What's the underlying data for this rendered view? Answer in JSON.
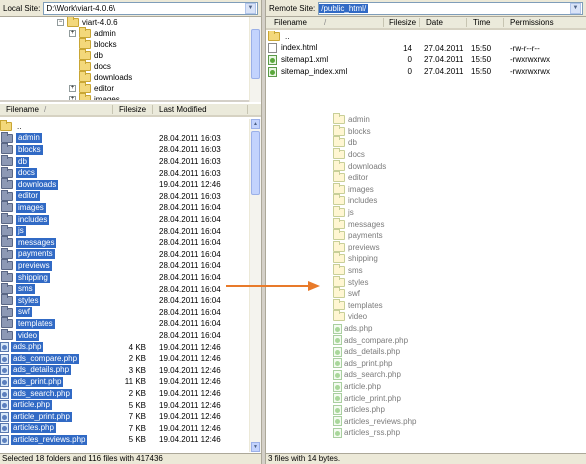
{
  "local": {
    "label": "Local Site:",
    "path": "D:\\Work\\viart-4.0.6\\",
    "tree": [
      {
        "name": "viart-4.0.6",
        "sign": "−",
        "indent": 0
      },
      {
        "name": "admin",
        "sign": "+",
        "indent": 1
      },
      {
        "name": "blocks",
        "sign": "",
        "indent": 1
      },
      {
        "name": "db",
        "sign": "",
        "indent": 1
      },
      {
        "name": "docs",
        "sign": "",
        "indent": 1
      },
      {
        "name": "downloads",
        "sign": "",
        "indent": 1
      },
      {
        "name": "editor",
        "sign": "+",
        "indent": 1
      },
      {
        "name": "images",
        "sign": "+",
        "indent": 1
      }
    ],
    "columns": {
      "name": "Filename",
      "size": "Filesize",
      "modified": "Last Modified",
      "sort": "/"
    },
    "up": "..",
    "rows": [
      {
        "n": "admin",
        "s": "",
        "m": "28.04.2011 16:03",
        "t": "d"
      },
      {
        "n": "blocks",
        "s": "",
        "m": "28.04.2011 16:03",
        "t": "d"
      },
      {
        "n": "db",
        "s": "",
        "m": "28.04.2011 16:03",
        "t": "d"
      },
      {
        "n": "docs",
        "s": "",
        "m": "28.04.2011 16:03",
        "t": "d"
      },
      {
        "n": "downloads",
        "s": "",
        "m": "19.04.2011 12:46",
        "t": "d"
      },
      {
        "n": "editor",
        "s": "",
        "m": "28.04.2011 16:03",
        "t": "d"
      },
      {
        "n": "images",
        "s": "",
        "m": "28.04.2011 16:04",
        "t": "d"
      },
      {
        "n": "includes",
        "s": "",
        "m": "28.04.2011 16:04",
        "t": "d"
      },
      {
        "n": "js",
        "s": "",
        "m": "28.04.2011 16:04",
        "t": "d"
      },
      {
        "n": "messages",
        "s": "",
        "m": "28.04.2011 16:04",
        "t": "d"
      },
      {
        "n": "payments",
        "s": "",
        "m": "28.04.2011 16:04",
        "t": "d"
      },
      {
        "n": "previews",
        "s": "",
        "m": "28.04.2011 16:04",
        "t": "d"
      },
      {
        "n": "shipping",
        "s": "",
        "m": "28.04.2011 16:04",
        "t": "d"
      },
      {
        "n": "sms",
        "s": "",
        "m": "28.04.2011 16:04",
        "t": "d"
      },
      {
        "n": "styles",
        "s": "",
        "m": "28.04.2011 16:04",
        "t": "d"
      },
      {
        "n": "swf",
        "s": "",
        "m": "28.04.2011 16:04",
        "t": "d"
      },
      {
        "n": "templates",
        "s": "",
        "m": "28.04.2011 16:04",
        "t": "d"
      },
      {
        "n": "video",
        "s": "",
        "m": "28.04.2011 16:04",
        "t": "d"
      },
      {
        "n": "ads.php",
        "s": "4 KB",
        "m": "19.04.2011 12:46",
        "t": "f"
      },
      {
        "n": "ads_compare.php",
        "s": "2 KB",
        "m": "19.04.2011 12:46",
        "t": "f"
      },
      {
        "n": "ads_details.php",
        "s": "3 KB",
        "m": "19.04.2011 12:46",
        "t": "f"
      },
      {
        "n": "ads_print.php",
        "s": "11 KB",
        "m": "19.04.2011 12:46",
        "t": "f"
      },
      {
        "n": "ads_search.php",
        "s": "2 KB",
        "m": "19.04.2011 12:46",
        "t": "f"
      },
      {
        "n": "article.php",
        "s": "5 KB",
        "m": "19.04.2011 12:46",
        "t": "f"
      },
      {
        "n": "article_print.php",
        "s": "7 KB",
        "m": "19.04.2011 12:46",
        "t": "f"
      },
      {
        "n": "articles.php",
        "s": "7 KB",
        "m": "19.04.2011 12:46",
        "t": "f"
      },
      {
        "n": "articles_reviews.php",
        "s": "5 KB",
        "m": "19.04.2011 12:46",
        "t": "f"
      }
    ],
    "status": "Selected 18 folders and 116 files with 417436"
  },
  "remote": {
    "label": "Remote Site:",
    "path": "/public_html/",
    "columns": {
      "name": "Filename",
      "sort": "/",
      "size": "Filesize",
      "date": "Date",
      "time": "Time",
      "perm": "Permissions"
    },
    "up": "..",
    "rows": [
      {
        "n": "index.html",
        "s": "14",
        "d": "27.04.2011",
        "t": "15:50",
        "p": "-rw-r--r--",
        "k": "html"
      },
      {
        "n": "sitemap1.xml",
        "s": "0",
        "d": "27.04.2011",
        "t": "15:50",
        "p": "-rwxrwxrwx",
        "k": "xml"
      },
      {
        "n": "sitemap_index.xml",
        "s": "0",
        "d": "27.04.2011",
        "t": "15:50",
        "p": "-rwxrwxrwx",
        "k": "xml"
      }
    ],
    "ghost": [
      "admin",
      "blocks",
      "db",
      "docs",
      "downloads",
      "editor",
      "images",
      "includes",
      "js",
      "messages",
      "payments",
      "previews",
      "shipping",
      "sms",
      "styles",
      "swf",
      "templates",
      "video",
      "ads.php",
      "ads_compare.php",
      "ads_details.php",
      "ads_print.php",
      "ads_search.php",
      "article.php",
      "article_print.php",
      "articles.php",
      "articles_reviews.php",
      "articles_rss.php"
    ],
    "status": "3 files with 14 bytes."
  },
  "colors": {
    "selection": "#316ac5",
    "arrow": "#e87a2a"
  },
  "icons": {
    "folder": "folder-icon",
    "file": "php-file-icon",
    "xml": "xml-file-icon",
    "drag": "drag-arrow"
  }
}
